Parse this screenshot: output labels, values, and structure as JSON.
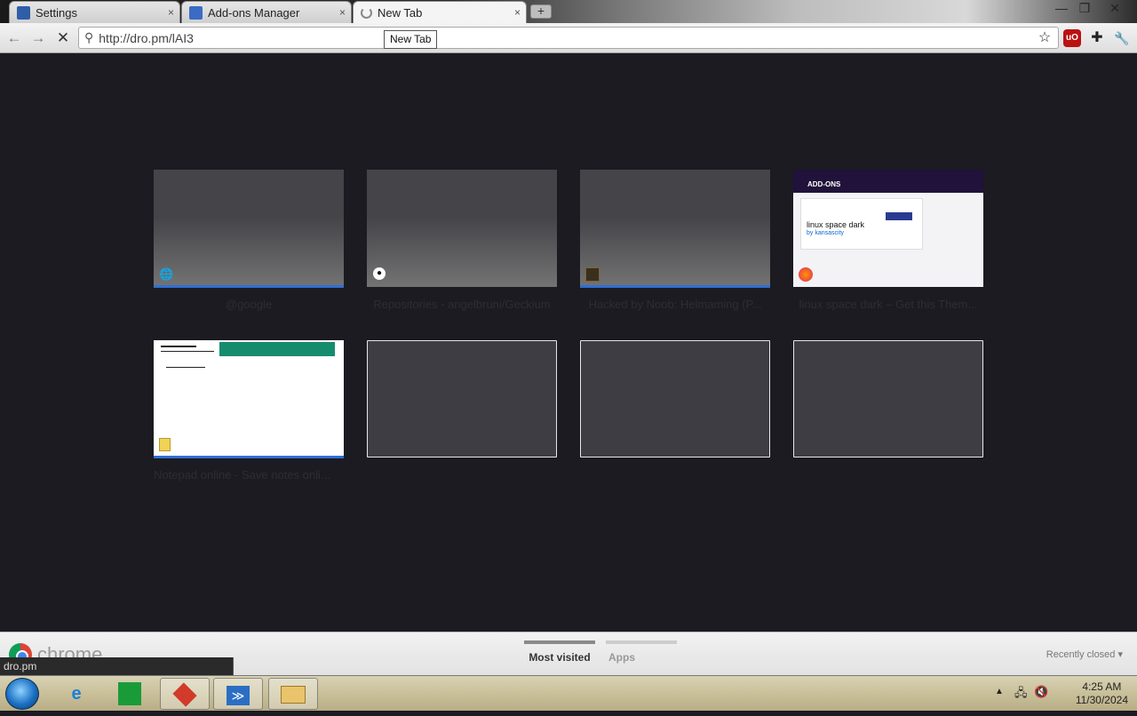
{
  "tabs": [
    {
      "title": "Settings",
      "close": "×"
    },
    {
      "title": "Add-ons Manager",
      "close": "×"
    },
    {
      "title": "New Tab",
      "close": "×",
      "active": true
    }
  ],
  "newtab_button": "+",
  "window_controls": {
    "minimize": "—",
    "restore": "❐",
    "close": "✕"
  },
  "toolbar": {
    "back": "←",
    "forward": "→",
    "stop": "✕",
    "url": "http://dro.pm/lAI3",
    "tooltip": "New Tab",
    "star": "☆",
    "ublock": "uO",
    "extensions": "✚",
    "wrench": "🔧"
  },
  "most_visited": [
    {
      "title": "@google",
      "favicon": "globe-icon"
    },
    {
      "title": "Repositories - angelbruni/Geckium",
      "favicon": "github-icon"
    },
    {
      "title": "Hacked by Noob: Helmaming (P...",
      "favicon": "site-icon"
    },
    {
      "title": "linux space dark – Get this Them...",
      "favicon": "firefox-icon"
    },
    {
      "title": "Notepad online - Save notes onli...",
      "favicon": "notepad-icon"
    }
  ],
  "addons_thumb": {
    "header": "ADD-ONS",
    "theme_name": "linux space dark",
    "author": "by kansascity"
  },
  "bottom_panel": {
    "brand": "chrome",
    "tabs": [
      "Most visited",
      "Apps"
    ],
    "recently_closed": "Recently closed ▾"
  },
  "status_bubble": "dro.pm",
  "taskbar": {
    "clock_time": "4:25 AM",
    "clock_date": "11/30/2024"
  }
}
